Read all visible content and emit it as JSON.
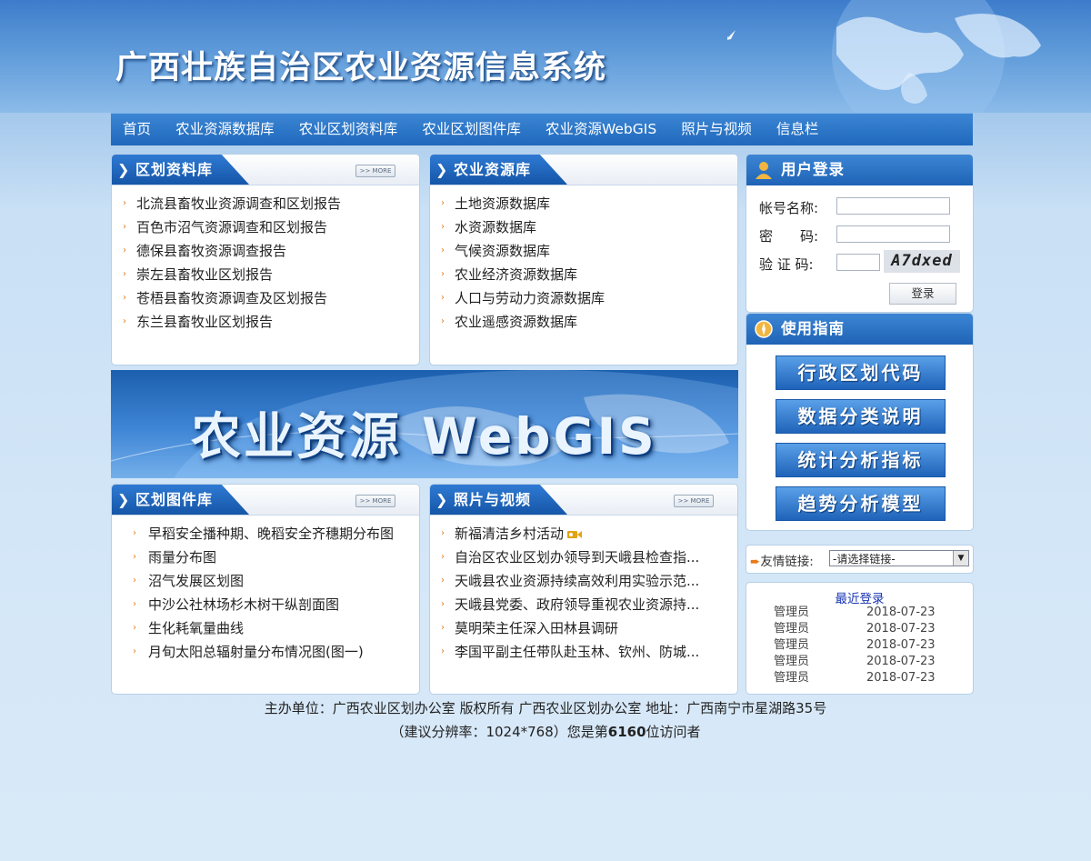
{
  "header": {
    "title": "广西壮族自治区农业资源信息系统"
  },
  "nav": {
    "items": [
      "首页",
      "农业资源数据库",
      "农业区划资料库",
      "农业区划图件库",
      "农业资源WebGIS",
      "照片与视频",
      "信息栏"
    ]
  },
  "panels": {
    "zoning": {
      "title": "区划资料库",
      "more": ">> MORE",
      "items": [
        "北流县畜牧业资源调查和区划报告",
        "百色市沼气资源调查和区划报告",
        "德保县畜牧资源调查报告",
        "崇左县畜牧业区划报告",
        "苍梧县畜牧资源调查及区划报告",
        "东兰县畜牧业区划报告"
      ]
    },
    "resources": {
      "title": "农业资源库",
      "items": [
        "土地资源数据库",
        "水资源数据库",
        "气候资源数据库",
        "农业经济资源数据库",
        "人口与劳动力资源数据库",
        "农业遥感资源数据库"
      ]
    },
    "maps": {
      "title": "区划图件库",
      "more": ">> MORE",
      "items": [
        "早稻安全播种期、晚稻安全齐穗期分布图",
        "雨量分布图",
        "沼气发展区划图",
        "中沙公社林场杉木树干纵剖面图",
        "生化耗氧量曲线",
        "月旬太阳总辐射量分布情况图(图一)"
      ]
    },
    "photos": {
      "title": "照片与视频",
      "more": ">> MORE",
      "items": [
        "新福清洁乡村活动",
        "自治区农业区划办领导到天峨县检查指...",
        "天峨县农业资源持续高效利用实验示范...",
        "天峨县党委、政府领导重视农业资源持...",
        "莫明荣主任深入田林县调研",
        "李国平副主任带队赴玉林、钦州、防城..."
      ]
    }
  },
  "banner": {
    "text": "农业资源 WebGIS"
  },
  "login": {
    "title": "用户登录",
    "account_label": "帐号名称:",
    "password_label": "密　　码:",
    "captcha_label": "验 证 码:",
    "captcha_text": "A7dxed",
    "button": "登录"
  },
  "guide": {
    "title": "使用指南",
    "buttons": [
      "行政区划代码",
      "数据分类说明",
      "统计分析指标",
      "趋势分析模型"
    ]
  },
  "links": {
    "label": "友情链接:",
    "selected": "-请选择链接-"
  },
  "recent": {
    "title": "最近登录",
    "rows": [
      {
        "user": "管理员",
        "date": "2018-07-23"
      },
      {
        "user": "管理员",
        "date": "2018-07-23"
      },
      {
        "user": "管理员",
        "date": "2018-07-23"
      },
      {
        "user": "管理员",
        "date": "2018-07-23"
      },
      {
        "user": "管理员",
        "date": "2018-07-23"
      }
    ]
  },
  "footer": {
    "line1": "主办单位：广西农业区划办公室 版权所有 广西农业区划办公室 地址：广西南宁市星湖路35号",
    "line2_prefix": "（建议分辨率：1024*768）您是第",
    "visitor_count": "6160",
    "line2_suffix": "位访问者"
  },
  "colors": {
    "nav": "#1f68bc",
    "accent": "#e77a1b",
    "link_blue": "#1a36b5"
  }
}
